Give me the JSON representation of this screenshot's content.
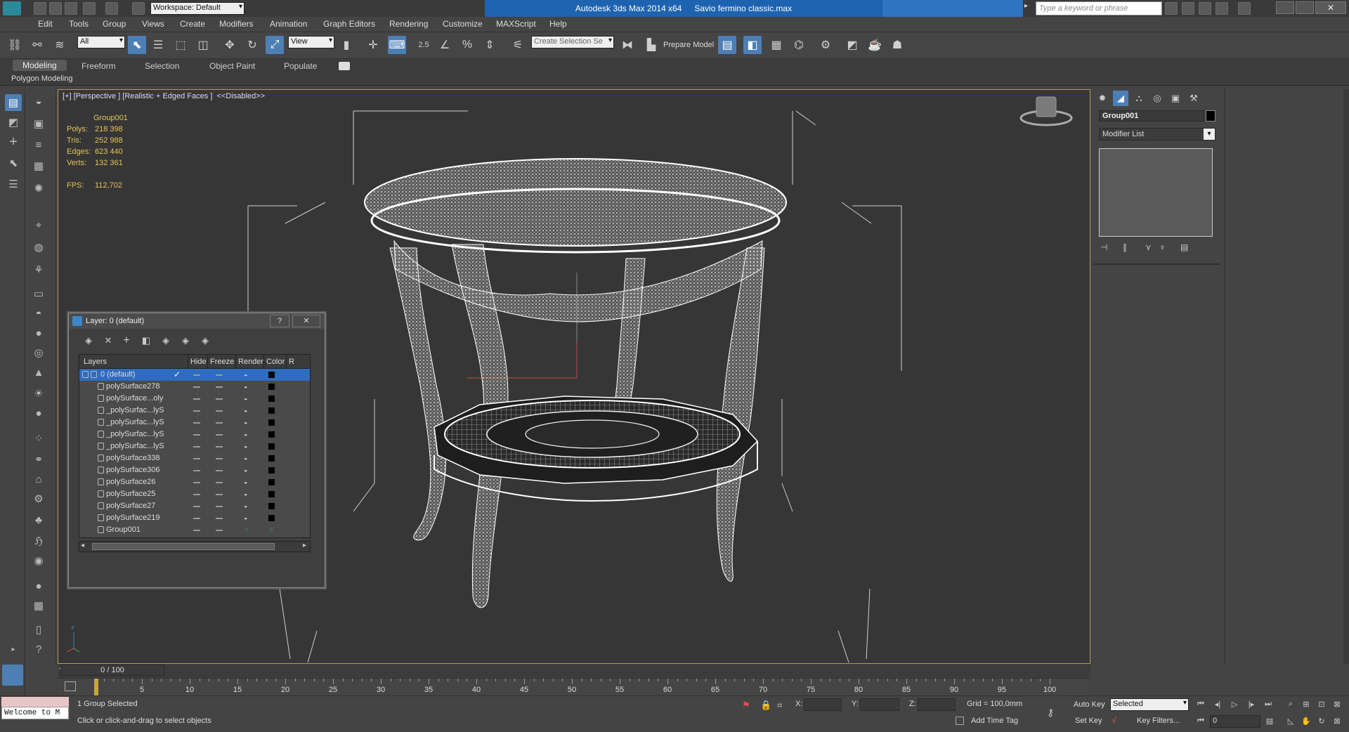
{
  "window": {
    "workspace_label": "Workspace: Default",
    "app_title": "Autodesk 3ds Max  2014 x64",
    "file_name": "Savio fermino classic.max",
    "search_placeholder": "Type a keyword or phrase"
  },
  "menu": [
    "Edit",
    "Tools",
    "Group",
    "Views",
    "Create",
    "Modifiers",
    "Animation",
    "Graph Editors",
    "Rendering",
    "Customize",
    "MAXScript",
    "Help"
  ],
  "toolbar": {
    "filter_value": "All",
    "refcoord_value": "View",
    "snap_label": "2.5",
    "selection_set_placeholder": "Create Selection Se",
    "prepare_model_label": "Prepare Model"
  },
  "ribbon": {
    "tabs": [
      "Modeling",
      "Freeform",
      "Selection",
      "Object Paint",
      "Populate"
    ],
    "active_tab": "Modeling",
    "sub_label": "Polygon Modeling"
  },
  "viewport": {
    "label": "[+] [Perspective ] [Realistic + Edged Faces ]  <<Disabled>>",
    "stats": {
      "object": "Group001",
      "polys_label": "Polys:",
      "polys": "218 398",
      "tris_label": "Tris:",
      "tris": "252 988",
      "edges_label": "Edges:",
      "edges": "623 440",
      "verts_label": "Verts:",
      "verts": "132 361",
      "fps_label": "FPS:",
      "fps": "112,702"
    },
    "axis_z": "z",
    "axis_x": "x",
    "axis_y": "y"
  },
  "layer_dialog": {
    "title": "Layer: 0 (default)",
    "help": "?",
    "close": "✕",
    "columns": [
      "Layers",
      "Hide",
      "Freeze",
      "Render",
      "Color",
      "R"
    ],
    "rows": [
      {
        "name": "0 (default)",
        "selected": true
      },
      {
        "name": "polySurface278"
      },
      {
        "name": "polySurface...oly"
      },
      {
        "name": "_polySurfac...lyS"
      },
      {
        "name": "_polySurfac...lyS"
      },
      {
        "name": "_polySurfac...lyS"
      },
      {
        "name": "_polySurfac...lyS"
      },
      {
        "name": "polySurface338"
      },
      {
        "name": "polySurface306"
      },
      {
        "name": "polySurface26"
      },
      {
        "name": "polySurface25"
      },
      {
        "name": "polySurface27"
      },
      {
        "name": "polySurface219"
      },
      {
        "name": "Group001",
        "group": true
      }
    ]
  },
  "right_panel": {
    "object_name": "Group001",
    "modifier_list": "Modifier List"
  },
  "timeline": {
    "frame_counter": "0 / 100",
    "ticks": [
      "0",
      "5",
      "10",
      "15",
      "20",
      "25",
      "30",
      "35",
      "40",
      "45",
      "50",
      "55",
      "60",
      "65",
      "70",
      "75",
      "80",
      "85",
      "90",
      "95",
      "100"
    ]
  },
  "status": {
    "welcome": "Welcome to M",
    "selection": "1 Group Selected",
    "prompt": "Click or click-and-drag to select objects",
    "x_label": "X:",
    "y_label": "Y:",
    "z_label": "Z:",
    "grid": "Grid = 100,0mm",
    "add_time_tag": "Add Time Tag",
    "auto_key": "Auto Key",
    "set_key": "Set Key",
    "selected_value": "Selected",
    "key_filters": "Key Filters...",
    "frame_value": "0"
  },
  "colors": {
    "accent_blue": "#4d7fb5",
    "title_blue": "#1d63b0",
    "stats_yellow": "#e5c35a",
    "viewport_border": "#b49a4c"
  }
}
